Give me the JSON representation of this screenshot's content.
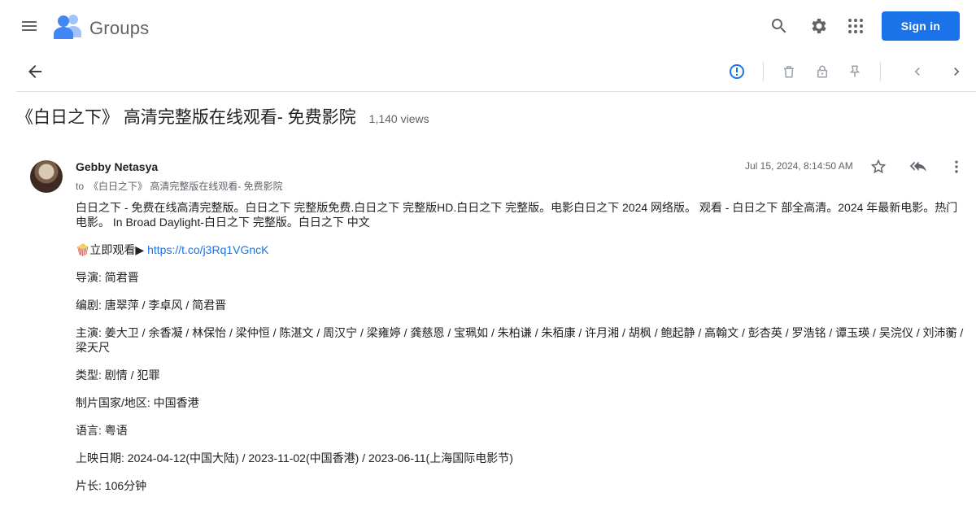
{
  "app": {
    "name": "Groups"
  },
  "header": {
    "menu_icon": "hamburger-menu-icon",
    "logo_icon": "groups-logo-icon",
    "search_icon": "search-icon",
    "settings_icon": "gear-icon",
    "apps_icon": "apps-grid-icon",
    "signin_label": "Sign in",
    "colors": {
      "accent": "#1a73e8",
      "logo_blue": "#4285f4",
      "logo_light": "#a1c2fa",
      "warning_blue": "#1a73e8"
    }
  },
  "toolbar": {
    "back_icon": "arrow-back-icon",
    "report_icon": "report-icon",
    "delete_icon": "delete-icon",
    "lock_icon": "lock-icon",
    "pin_icon": "pin-icon",
    "prev_icon": "chevron-left-icon",
    "next_icon": "chevron-right-icon"
  },
  "thread": {
    "title": "《白日之下》 高清完整版在线观看- 免费影院",
    "views": "1,140 views"
  },
  "message": {
    "author": "Gebby Netasya",
    "to_prefix": "to",
    "to_group": "《白日之下》 高清完整版在线观看- 免费影院",
    "date": "Jul 15, 2024, 8:14:50 AM",
    "star_icon": "star-outline-icon",
    "reply_all_icon": "reply-all-icon",
    "more_icon": "more-vert-icon",
    "paragraphs": [
      "白日之下 - 免费在线高清完整版。白日之下 完整版免费.白日之下 完整版HD.白日之下 完整版。电影白日之下 2024 网络版。 观看 - 白日之下 部全高清。2024 年最新电影。热门电影。 In Broad Daylight-白日之下 完整版。白日之下 中文",
      "导演: 简君晋",
      "编剧: 唐翠萍 / 李卓风 / 简君晋",
      "主演: 姜大卫 / 余香凝 / 林保怡 / 梁仲恒 / 陈湛文 / 周汉宁 / 梁雍婷 / 龚慈恩 / 宝珮如 / 朱柏谦 / 朱栢康 / 许月湘 / 胡枫 / 鲍起静 / 高翰文 / 彭杏英 / 罗浩铭 / 谭玉瑛 / 吴浣仪 / 刘沛蘅 / 梁天尺",
      "类型: 剧情 / 犯罪",
      "制片国家/地区: 中国香港",
      "语言: 粤语",
      "上映日期: 2024-04-12(中国大陆) / 2023-11-02(中国香港) / 2023-06-11(上海国际电影节)",
      "片长: 106分钟"
    ],
    "watch_prefix": "🍿立即观看▶",
    "watch_link": "https://t.co/j3Rq1VGncK"
  }
}
